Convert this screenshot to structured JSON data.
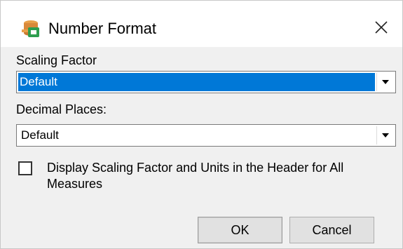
{
  "window": {
    "title": "Number Format",
    "icon": "app-icon",
    "close_icon": "close-icon"
  },
  "scaling": {
    "label": "Scaling Factor",
    "selected": "Default"
  },
  "decimals": {
    "label": "Decimal Places:",
    "selected": "Default"
  },
  "option": {
    "checked": false,
    "label": "Display Scaling Factor and Units in the Header for All Measures"
  },
  "buttons": {
    "ok": "OK",
    "cancel": "Cancel"
  },
  "colors": {
    "selection": "#0078d7",
    "background": "#f0f0f0"
  }
}
